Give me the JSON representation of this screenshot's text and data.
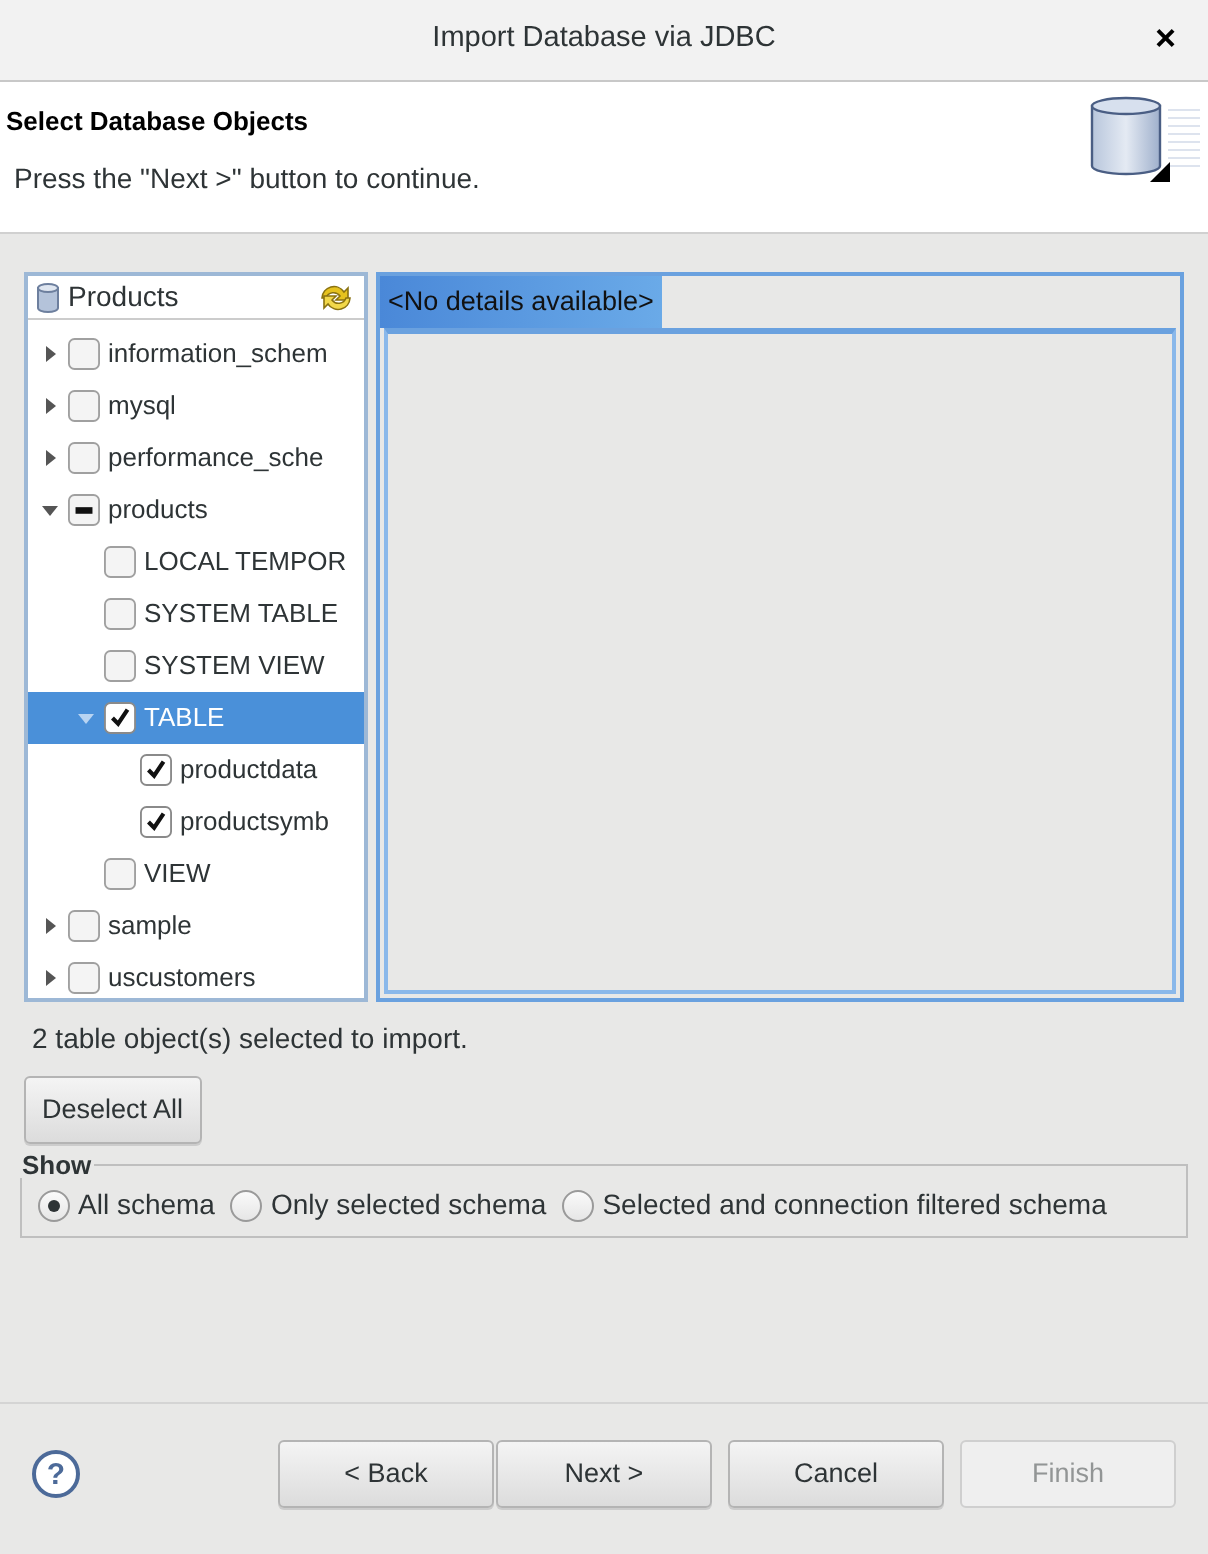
{
  "window": {
    "title": "Import Database via JDBC",
    "close": "×"
  },
  "header": {
    "title": "Select Database Objects",
    "description": "Press the \"Next >\" button to continue."
  },
  "tree": {
    "title": "Products",
    "items": [
      {
        "label": "information_schem",
        "expanded": false,
        "checked": false,
        "mixed": false,
        "selected": false
      },
      {
        "label": "mysql",
        "expanded": false,
        "checked": false,
        "mixed": false,
        "selected": false
      },
      {
        "label": "performance_sche",
        "expanded": false,
        "checked": false,
        "mixed": false,
        "selected": false
      },
      {
        "label": "products",
        "expanded": true,
        "checked": false,
        "mixed": true,
        "selected": false,
        "children": [
          {
            "label": "LOCAL TEMPOR",
            "checked": false,
            "mixed": false,
            "selected": false
          },
          {
            "label": "SYSTEM TABLE",
            "checked": false,
            "mixed": false,
            "selected": false
          },
          {
            "label": "SYSTEM VIEW",
            "checked": false,
            "mixed": false,
            "selected": false
          },
          {
            "label": "TABLE",
            "expanded": true,
            "checked": true,
            "mixed": false,
            "selected": true,
            "children": [
              {
                "label": "productdata",
                "checked": true,
                "mixed": false,
                "selected": false
              },
              {
                "label": "productsymb",
                "checked": true,
                "mixed": false,
                "selected": false
              }
            ]
          },
          {
            "label": "VIEW",
            "checked": false,
            "mixed": false,
            "selected": false
          }
        ]
      },
      {
        "label": "sample",
        "expanded": false,
        "checked": false,
        "mixed": false,
        "selected": false
      },
      {
        "label": "uscustomers",
        "expanded": false,
        "checked": false,
        "mixed": false,
        "selected": false
      }
    ]
  },
  "details": {
    "tabs": [
      {
        "label": "<No details available>",
        "selected": true
      }
    ]
  },
  "status": "2 table object(s) selected to import.",
  "deselect_button": "Deselect All",
  "show": {
    "legend": "Show",
    "options": [
      {
        "label": "All schema",
        "selected": true
      },
      {
        "label": "Only selected schema",
        "selected": false
      },
      {
        "label": "Selected and connection filtered schema",
        "selected": false
      }
    ]
  },
  "help_icon": "?",
  "buttons": [
    {
      "label": "< Back",
      "disabled": false
    },
    {
      "label": "Next >",
      "disabled": false
    },
    {
      "label": "Cancel",
      "disabled": false
    },
    {
      "label": "Finish",
      "disabled": true
    }
  ]
}
